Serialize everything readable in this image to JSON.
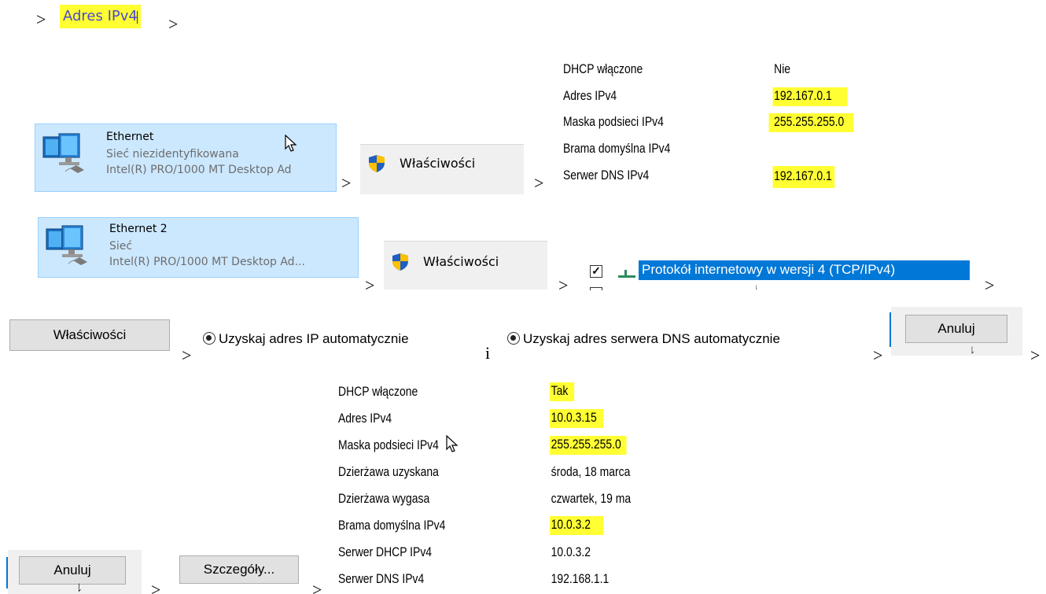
{
  "step1": {
    "label": "Adres IPv4"
  },
  "arrow": ">",
  "conjunction": "i",
  "adapter1": {
    "name": "Ethernet",
    "status": "Sieć niezidentyfikowana",
    "hardware": "Intel(R) PRO/1000 MT Desktop Ad"
  },
  "adapter2": {
    "name": "Ethernet 2",
    "status": "Sieć",
    "hardware": "Intel(R) PRO/1000 MT Desktop Ad..."
  },
  "properties_label": "Właściwości",
  "details1": {
    "rows": [
      {
        "key": "DHCP włączone",
        "value": "Nie",
        "highlight": false
      },
      {
        "key": "Adres IPv4",
        "value": "192.167.0.1",
        "highlight": true
      },
      {
        "key": "Maska podsieci IPv4",
        "value": "255.255.255.0",
        "highlight": true
      },
      {
        "key": "Brama domyślna IPv4",
        "value": "",
        "highlight": false
      },
      {
        "key": "Serwer DNS IPv4",
        "value": "192.167.0.1",
        "highlight": true
      }
    ]
  },
  "protocol": {
    "checked": true,
    "label": "Protokół internetowy w wersji 4 (TCP/IPv4)"
  },
  "radio_ip": "Uzyskaj adres IP automatycznie",
  "radio_dns": "Uzyskaj adres serwera DNS automatycznie",
  "cancel_label": "Anuluj",
  "details_button_label": "Szczegóły...",
  "details2": {
    "rows": [
      {
        "key": "DHCP włączone",
        "value": "Tak",
        "highlight": true
      },
      {
        "key": "Adres IPv4",
        "value": "10.0.3.15",
        "highlight": true
      },
      {
        "key": "Maska podsieci IPv4",
        "value": "255.255.255.0",
        "highlight": true
      },
      {
        "key": "Dzierżawa uzyskana",
        "value": "środa, 18 marca",
        "highlight": false
      },
      {
        "key": "Dzierżawa wygasa",
        "value": "czwartek, 19 ma",
        "highlight": false
      },
      {
        "key": "Brama domyślna IPv4",
        "value": "10.0.3.2",
        "highlight": true
      },
      {
        "key": "Serwer DHCP IPv4",
        "value": "10.0.3.2",
        "highlight": false
      },
      {
        "key": "Serwer DNS IPv4",
        "value": "192.168.1.1",
        "highlight": false
      }
    ]
  },
  "colors": {
    "highlight": "#ffff33",
    "selection": "#0078d7",
    "tile": "#cce8ff",
    "button": "#e1e1e1"
  }
}
